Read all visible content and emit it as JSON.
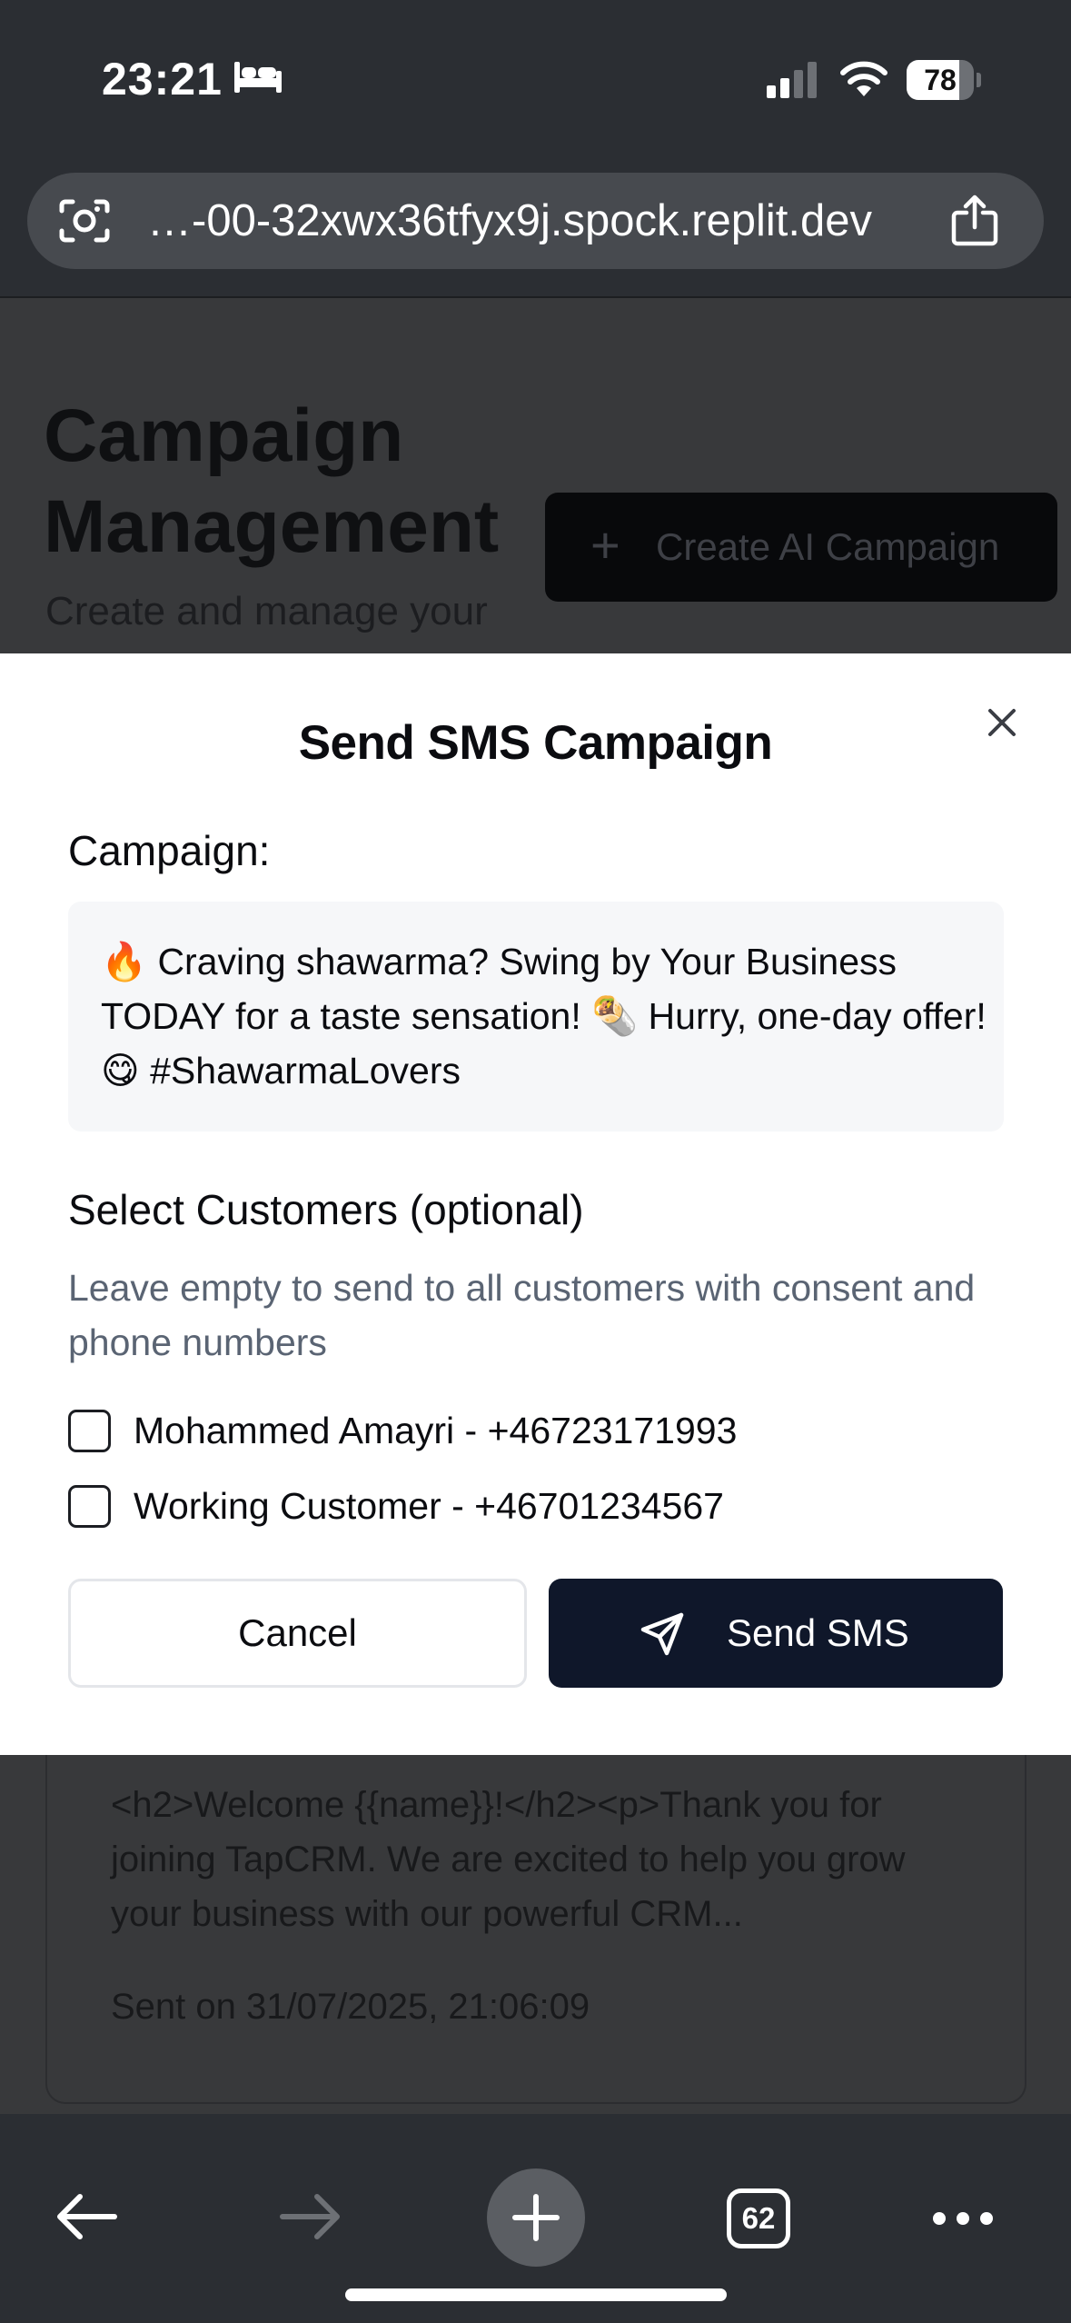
{
  "status_bar": {
    "time": "23:21",
    "battery_level": 78,
    "battery_label": "78",
    "icons": [
      "bed-icon",
      "cellular-signal-icon",
      "wifi-icon",
      "battery-icon"
    ]
  },
  "browser": {
    "url": "…-00-32xwx36tfyx9j.spock.replit.dev",
    "icons": [
      "scan-icon",
      "share-icon"
    ]
  },
  "background_page": {
    "title": "Campaign Management",
    "subtitle": "Create and manage your",
    "create_button_label": "Create AI Campaign",
    "card_preview": "<h2>Welcome {{name}}!</h2><p>Thank you for joining TapCRM. We are excited to help you grow your business with our powerful CRM...",
    "card_date": "Sent on 31/07/2025, 21:06:09"
  },
  "modal": {
    "title": "Send SMS Campaign",
    "campaign_label": "Campaign:",
    "campaign_message": "🔥 Craving shawarma? Swing by Your Business TODAY for a taste sensation! 🌯 Hurry, one-day offer! 😋 #ShawarmaLovers",
    "select_label": "Select Customers (optional)",
    "hint": "Leave empty to send to all customers with consent and phone numbers",
    "customers": [
      {
        "label": "Mohammed Amayri - +46723171993",
        "checked": false
      },
      {
        "label": "Working Customer - +46701234567",
        "checked": false
      }
    ],
    "cancel_label": "Cancel",
    "send_label": "Send SMS"
  },
  "toolbar": {
    "tab_count": "62",
    "icons": [
      "back-arrow-icon",
      "forward-arrow-icon",
      "plus-icon",
      "tabs-icon",
      "more-icon"
    ]
  },
  "colors": {
    "chrome": "#2b2e33",
    "overlay_page": "#38393b",
    "primary_button": "#0f172a",
    "message_box": "#f6f7f9",
    "hint_text": "#5a6473"
  }
}
